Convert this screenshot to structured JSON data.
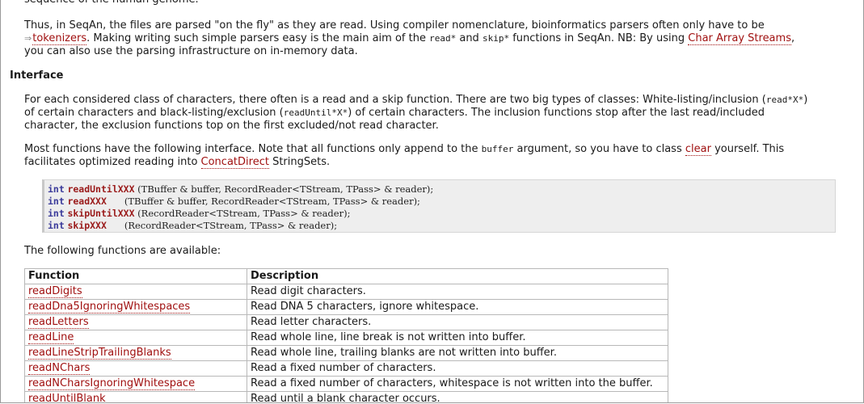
{
  "top_fragment": "sequence of the human genome.",
  "paragraph1": {
    "text_a": "Thus, in SeqAn, the files are parsed \"on the fly\" as they are read. Using compiler nomenclature, bioinformatics parsers often only have to be",
    "ext_icon": "external-link-icon",
    "link_tokenizers": "tokenizers",
    "text_b": ". Making writing such simple parsers easy is the main aim of the ",
    "code_read": "read*",
    "text_c": " and ",
    "code_skip": "skip*",
    "text_d": " functions in SeqAn. NB: By using ",
    "link_char_array": "Char Array Streams",
    "text_e": ",",
    "text_f": "you can also use the parsing infrastructure on in-memory data."
  },
  "heading_interface": "Interface",
  "paragraph2": {
    "text_a": "For each considered class of characters, there often is a read and a skip function. There are two big types of classes: White-listing/inclusion (",
    "code_a": "read*X*",
    "text_b": ")",
    "text_c": "of certain characters and black-listing/exclusion (",
    "code_b": "readUntil*X*",
    "text_d": ") of certain characters. The inclusion functions stop after the last read/included",
    "text_e": "character, the exclusion functions top on the first excluded/not read character."
  },
  "paragraph3": {
    "text_a": "Most functions have the following interface. Note that all functions only append to the ",
    "code_buffer": "buffer",
    "text_b": " argument, so you have to class ",
    "link_clear": "clear",
    "text_c": " yourself. This",
    "text_d": "facilitates optimized reading into ",
    "link_concat": "ConcatDirect",
    "text_e": " StringSets."
  },
  "code_lines": [
    {
      "kw": "int",
      "fn": "readUntilXXX",
      "rest": " (TBuffer & buffer, RecordReader<TStream, TPass> & reader);"
    },
    {
      "kw": "int",
      "fn": "readXXX",
      "rest": "      (TBuffer & buffer, RecordReader<TStream, TPass> & reader);"
    },
    {
      "kw": "int",
      "fn": "skipUntilXXX",
      "rest": " (RecordReader<TStream, TPass> & reader);"
    },
    {
      "kw": "int",
      "fn": "skipXXX",
      "rest": "      (RecordReader<TStream, TPass> & reader);"
    }
  ],
  "paragraph4": "The following functions are available:",
  "table": {
    "headers": [
      "Function",
      "Description"
    ],
    "rows": [
      [
        "readDigits",
        "Read digit characters."
      ],
      [
        "readDna5IgnoringWhitespaces",
        "Read DNA 5 characters, ignore whitespace."
      ],
      [
        "readLetters",
        "Read letter characters."
      ],
      [
        "readLine",
        "Read whole line, line break is not written into buffer."
      ],
      [
        "readLineStripTrailingBlanks",
        "Read whole line, trailing blanks are not written into buffer."
      ],
      [
        "readNChars",
        "Read a fixed number of characters."
      ],
      [
        "readNCharsIgnoringWhitespace",
        "Read a fixed number of characters, whitespace is not written into the buffer."
      ],
      [
        "readUntilBlank",
        "Read until a blank character occurs."
      ]
    ]
  }
}
